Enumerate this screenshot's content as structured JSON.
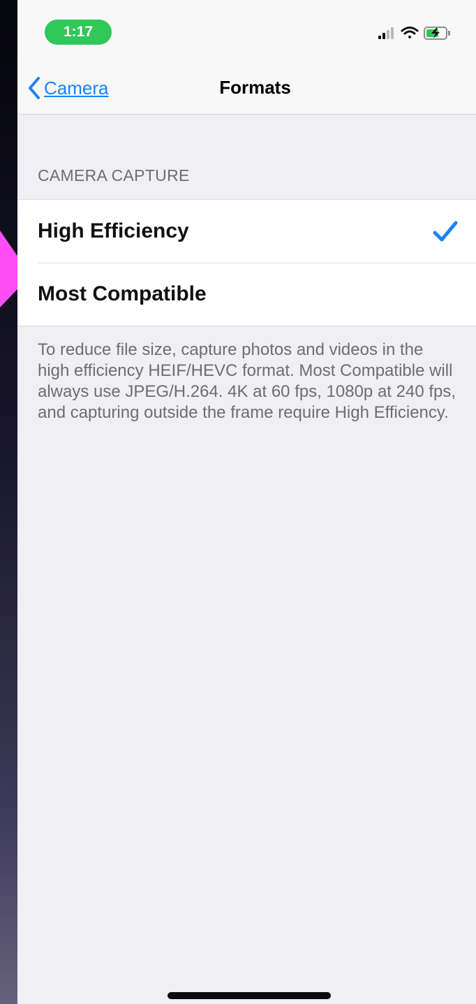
{
  "colors": {
    "accent": "#1a82fb",
    "status_pill": "#32c759",
    "annotation_arrow": "#ff4cf4",
    "background": "#efeff4"
  },
  "status_bar": {
    "time": "1:17",
    "icons": [
      "signal-icon",
      "wifi-icon",
      "battery-charging-icon"
    ]
  },
  "nav": {
    "back_label": "Camera",
    "back_icon": "chevron-left-icon",
    "title": "Formats"
  },
  "section": {
    "header": "CAMERA CAPTURE",
    "options": [
      {
        "label": "High Efficiency",
        "selected": true
      },
      {
        "label": "Most Compatible",
        "selected": false
      }
    ],
    "footer": "To reduce file size, capture photos and videos in the high efficiency HEIF/HEVC format. Most Compatible will always use JPEG/H.264. 4K at 60 fps, 1080p at 240 fps, and capturing outside the frame require High Efficiency."
  }
}
